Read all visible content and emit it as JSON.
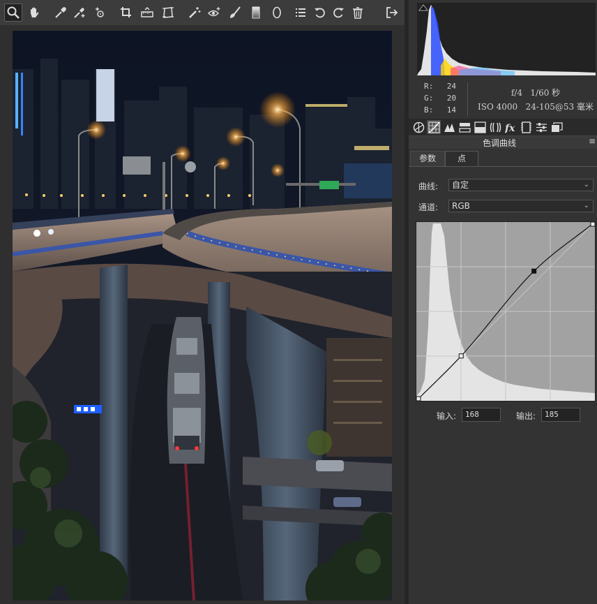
{
  "toolbar": {
    "tools": [
      {
        "name": "zoom-tool",
        "icon": "magnifier-icon",
        "active": true
      },
      {
        "name": "hand-tool",
        "icon": "hand-icon"
      },
      {
        "name": "white-balance-tool",
        "icon": "eyedropper-icon"
      },
      {
        "name": "color-sampler-tool",
        "icon": "color-sampler-icon"
      },
      {
        "name": "targeted-adjustment-tool",
        "icon": "target-adjust-icon"
      },
      {
        "name": "crop-tool",
        "icon": "crop-icon"
      },
      {
        "name": "straighten-tool",
        "icon": "straighten-icon"
      },
      {
        "name": "transform-tool",
        "icon": "transform-icon"
      },
      {
        "name": "spot-removal-tool",
        "icon": "spot-removal-icon"
      },
      {
        "name": "red-eye-tool",
        "icon": "red-eye-icon"
      },
      {
        "name": "adjustment-brush-tool",
        "icon": "brush-icon"
      },
      {
        "name": "graduated-filter-tool",
        "icon": "graduated-filter-icon"
      },
      {
        "name": "radial-filter-tool",
        "icon": "radial-filter-icon"
      },
      {
        "name": "preferences-button",
        "icon": "list-icon"
      },
      {
        "name": "rotate-left-button",
        "icon": "rotate-ccw-icon"
      },
      {
        "name": "rotate-right-button",
        "icon": "rotate-cw-icon"
      },
      {
        "name": "delete-button",
        "icon": "trash-icon"
      }
    ],
    "exit_icon": "exit-icon"
  },
  "info": {
    "r_label": "R:",
    "r_value": "24",
    "g_label": "G:",
    "g_value": "20",
    "b_label": "B:",
    "b_value": "14",
    "aperture": "f/4",
    "shutter": "1/60 秒",
    "iso": "ISO 4000",
    "lens": "24-105@53 毫米"
  },
  "panel_icons": [
    "basic-icon",
    "tone-curve-icon",
    "detail-icon",
    "hsl-icon",
    "split-toning-icon",
    "lens-icon",
    "fx-icon",
    "camera-calibration-icon",
    "presets-icon",
    "snapshots-icon"
  ],
  "panel": {
    "title": "色调曲线",
    "menu_glyph": "≡",
    "tabs": {
      "params": "参数",
      "point": "点"
    },
    "curve_label": "曲线:",
    "curve_value": "自定",
    "channel_label": "通道:",
    "channel_value": "RGB",
    "input_label": "输入:",
    "input_value": "168",
    "output_label": "输出:",
    "output_value": "185"
  },
  "curve": {
    "points": [
      [
        0,
        0
      ],
      [
        64,
        64
      ],
      [
        168,
        185
      ],
      [
        255,
        255
      ]
    ],
    "selected_point": [
      168,
      185
    ]
  },
  "colors": {
    "toolbar_bg": "#3c3c3c",
    "panel_bg": "#333333",
    "curve_bg": "#a2a2a2",
    "histogram_fill": "#e4e4e4"
  }
}
